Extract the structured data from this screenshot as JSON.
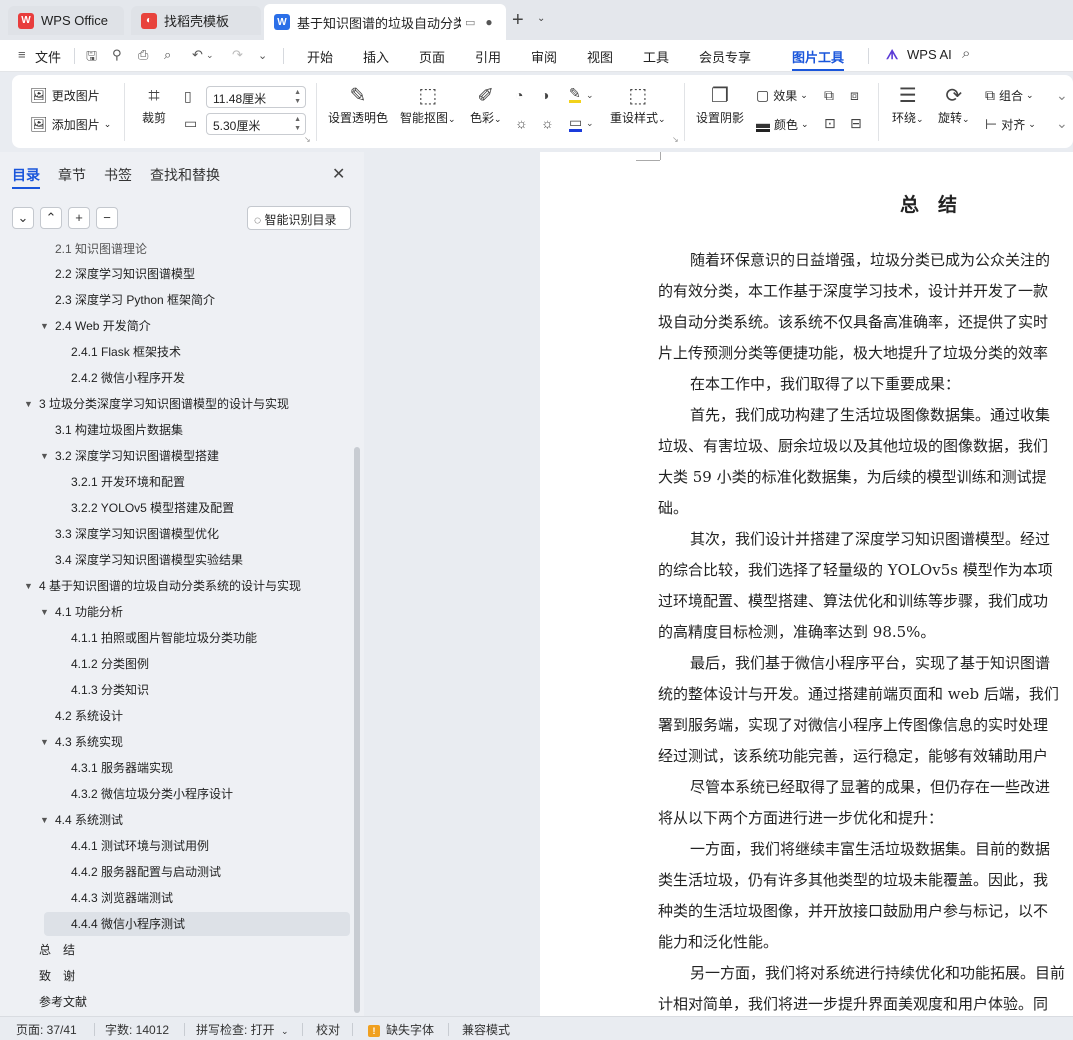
{
  "tabs": {
    "wps": "WPS Office",
    "templates": "找稻壳模板",
    "document": "基于知识图谱的垃圾自动分类"
  },
  "menu": {
    "file": "文件",
    "items": [
      "开始",
      "插入",
      "页面",
      "引用",
      "审阅",
      "视图",
      "工具",
      "会员专享",
      "图片工具"
    ],
    "active": "图片工具",
    "ai": "WPS AI"
  },
  "ribbon": {
    "change_image": "更改图片",
    "add_image": "添加图片",
    "crop": "裁剪",
    "width_value": "11.48厘米",
    "height_value": "5.30厘米",
    "set_transparent": "设置透明色",
    "smart_cutout": "智能抠图",
    "color": "色彩",
    "reset_style": "重设样式",
    "set_shadow": "设置阴影",
    "effects": "效果",
    "color2": "颜色",
    "wrap": "环绕",
    "rotate": "旋转",
    "group": "组合",
    "align": "对齐"
  },
  "sidebar": {
    "tabs": [
      "目录",
      "章节",
      "书签",
      "查找和替换"
    ],
    "smart_toc": "智能识别目录",
    "toc": [
      "2.1  知识图谱理论",
      "2.2  深度学习知识图谱模型",
      "2.3  深度学习 Python 框架简介",
      "2.4 Web 开发简介",
      "2.4.1 Flask 框架技术",
      "2.4.2  微信小程序开发",
      "3  垃圾分类深度学习知识图谱模型的设计与实现",
      "3.1  构建垃圾图片数据集",
      "3.2  深度学习知识图谱模型搭建",
      "3.2.1  开发环境和配置",
      "3.2.2 YOLOv5 模型搭建及配置",
      "3.3  深度学习知识图谱模型优化",
      "3.4  深度学习知识图谱模型实验结果",
      "4  基于知识图谱的垃圾自动分类系统的设计与实现",
      "4.1  功能分析",
      "4.1.1  拍照或图片智能垃圾分类功能",
      "4.1.2  分类图例",
      "4.1.3  分类知识",
      "4.2  系统设计",
      "4.3  系统实现",
      "4.3.1  服务器端实现",
      "4.3.2  微信垃圾分类小程序设计",
      "4.4  系统测试",
      "4.4.1  测试环境与测试用例",
      "4.4.2  服务器配置与启动测试",
      "4.4.3  浏览器端测试",
      "4.4.4  微信小程序测试",
      "总　结",
      "致　谢",
      "参考文献"
    ]
  },
  "document": {
    "title": "总　结",
    "lines": [
      "随着环保意识的日益增强，垃圾分类已成为公众关注的",
      "的有效分类，本工作基于深度学习技术，设计并开发了一款",
      "圾自动分类系统。该系统不仅具备高准确率，还提供了实时",
      "片上传预测分类等便捷功能，极大地提升了垃圾分类的效率",
      "在本工作中，我们取得了以下重要成果：",
      "首先，我们成功构建了生活垃圾图像数据集。通过收集",
      "垃圾、有害垃圾、厨余垃圾以及其他垃圾的图像数据，我们",
      "大类 59 小类的标准化数据集，为后续的模型训练和测试提",
      "础。",
      "其次，我们设计并搭建了深度学习知识图谱模型。经过",
      "的综合比较，我们选择了轻量级的 YOLOv5s 模型作为本项",
      "过环境配置、模型搭建、算法优化和训练等步骤，我们成功",
      "的高精度目标检测，准确率达到 98.5%。",
      "最后，我们基于微信小程序平台，实现了基于知识图谱",
      "统的整体设计与开发。通过搭建前端页面和 web 后端，我们",
      "署到服务端，实现了对微信小程序上传图像信息的实时处理",
      "经过测试，该系统功能完善，运行稳定，能够有效辅助用户",
      "尽管本系统已经取得了显著的成果，但仍存在一些改进",
      "将从以下两个方面进行进一步优化和提升：",
      "一方面，我们将继续丰富生活垃圾数据集。目前的数据",
      "类生活垃圾，仍有许多其他类型的垃圾未能覆盖。因此，我",
      "种类的生活垃圾图像，并开放接口鼓励用户参与标记，以不",
      "能力和泛化性能。",
      "另一方面，我们将对系统进行持续优化和功能拓展。目前",
      "计相对简单，我们将进一步提升界面美观度和用户体验。同"
    ]
  },
  "status": {
    "page": "页面: 37/41",
    "words": "字数: 14012",
    "spell": "拼写检查: 打开",
    "proof": "校对",
    "missing_font": "缺失字体",
    "compat": "兼容模式"
  },
  "colors": {
    "accent": "#1a56db",
    "wps_red": "#e83d3d",
    "doc_blue": "#2b6fe8"
  }
}
